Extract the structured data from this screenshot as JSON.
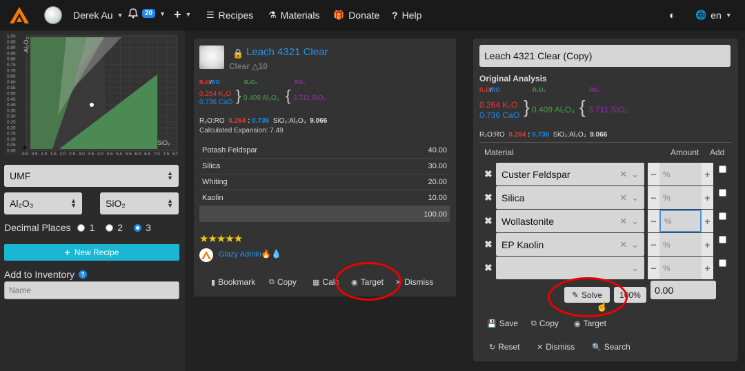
{
  "nav": {
    "user": "Derek Au",
    "notif_count": "20",
    "recipes": "Recipes",
    "materials": "Materials",
    "donate": "Donate",
    "help": "Help",
    "lang": "en"
  },
  "sidebar": {
    "chart": {
      "ylabel": "Al₂O₃",
      "xlabel": "SiO₂",
      "y_ticks": [
        "1.00",
        "0.95",
        "0.90",
        "0.85",
        "0.80",
        "0.75",
        "0.70",
        "0.65",
        "0.60",
        "0.55",
        "0.50",
        "0.45",
        "0.40",
        "0.35",
        "0.30",
        "0.25",
        "0.20",
        "0.15",
        "0.10",
        "0.05",
        "0.00"
      ],
      "x_ticks": [
        "0.0",
        "0.5",
        "1.0",
        "1.5",
        "2.0",
        "2.5",
        "3.0",
        "3.5",
        "4.0",
        "4.5",
        "5.0",
        "5.5",
        "6.0",
        "6.5",
        "7.0",
        "7.5",
        "8.0"
      ]
    },
    "umf_select": "UMF",
    "x_select": "Al₂O₃",
    "y_select": "SiO₂",
    "decimal_label": "Decimal Places",
    "decimal_options": [
      "1",
      "2",
      "3"
    ],
    "new_recipe": "New Recipe",
    "inventory_label": "Add to Inventory",
    "name_placeholder": "Name"
  },
  "recipe": {
    "title": "Leach 4321 Clear",
    "cone": "Clear △10",
    "heads": {
      "r2o_ro_a": "R₂O",
      "r2o_ro_b": "RO",
      "r2o3": "R₂O₃",
      "ro2": "RO₂"
    },
    "k2o": "0.264 K₂O",
    "cao": "0.736 CaO",
    "al2o3": "0.409 Al₂O₃",
    "sio2": "3.711 SiO₂",
    "ratio_label": "R₂O:RO",
    "ratio_a": "0.264",
    "ratio_sep": ":",
    "ratio_b": "0.736",
    "si_al_label": "SiO₂:Al₂O₃",
    "si_al": "9.066",
    "expansion": "Calculated Expansion: 7.49",
    "materials": [
      {
        "name": "Potash Feldspar",
        "amount": "40.00"
      },
      {
        "name": "Silica",
        "amount": "30.00"
      },
      {
        "name": "Whiting",
        "amount": "20.00"
      },
      {
        "name": "Kaolin",
        "amount": "10.00"
      }
    ],
    "total": "100.00",
    "stars": "★★★★★",
    "admin": "Glazy Admin",
    "flames": "🔥💧",
    "actions": {
      "bookmark": "Bookmark",
      "copy": "Copy",
      "calc": "Calc",
      "target": "Target",
      "dismiss": "Dismiss"
    }
  },
  "editor": {
    "title_value": "Leach 4321 Clear (Copy)",
    "orig_label": "Original Analysis",
    "col_material": "Material",
    "col_amount": "Amount",
    "col_add": "Add",
    "rows": [
      {
        "material": "Custer Feldspar",
        "amount_ph": "%"
      },
      {
        "material": "Silica",
        "amount_ph": "%"
      },
      {
        "material": "Wollastonite",
        "amount_ph": "%"
      },
      {
        "material": "EP Kaolin",
        "amount_ph": "%"
      },
      {
        "material": "",
        "amount_ph": "%"
      }
    ],
    "solve": "Solve",
    "pct100": "100%",
    "total_value": "0.00",
    "actions": {
      "save": "Save",
      "copy": "Copy",
      "target": "Target",
      "reset": "Reset",
      "dismiss": "Dismiss",
      "search": "Search"
    }
  }
}
